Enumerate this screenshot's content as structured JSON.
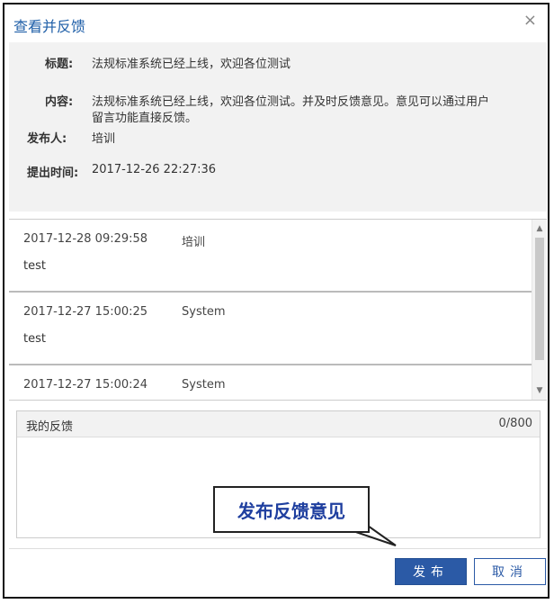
{
  "dialog": {
    "title": "查看并反馈",
    "close_glyph": "×"
  },
  "info": {
    "title_label": "标题:",
    "title_value": "法规标准系统已经上线，欢迎各位测试",
    "content_label": "内容:",
    "content_value_line1": "法规标准系统已经上线，欢迎各位测试。并及时反馈意见。意见可以通过用户",
    "content_value_line2": "留言功能直接反馈。",
    "publisher_label": "发布人:",
    "publisher_value": "培训",
    "submit_time_label": "提出时间:",
    "submit_time_value": "2017-12-26 22:27:36"
  },
  "comments": [
    {
      "time": "2017-12-28 09:29:58",
      "user": "培训",
      "content": "test"
    },
    {
      "time": "2017-12-27 15:00:25",
      "user": "System",
      "content": "test"
    },
    {
      "time": "2017-12-27 15:00:24",
      "user": "System",
      "content": ""
    }
  ],
  "feedback": {
    "label": "我的反馈",
    "count": "0/800",
    "value": ""
  },
  "callout": {
    "text": "发布反馈意见"
  },
  "buttons": {
    "publish": "发布",
    "cancel": "取消"
  },
  "scrollbar": {
    "up_glyph": "▲",
    "down_glyph": "▼"
  }
}
